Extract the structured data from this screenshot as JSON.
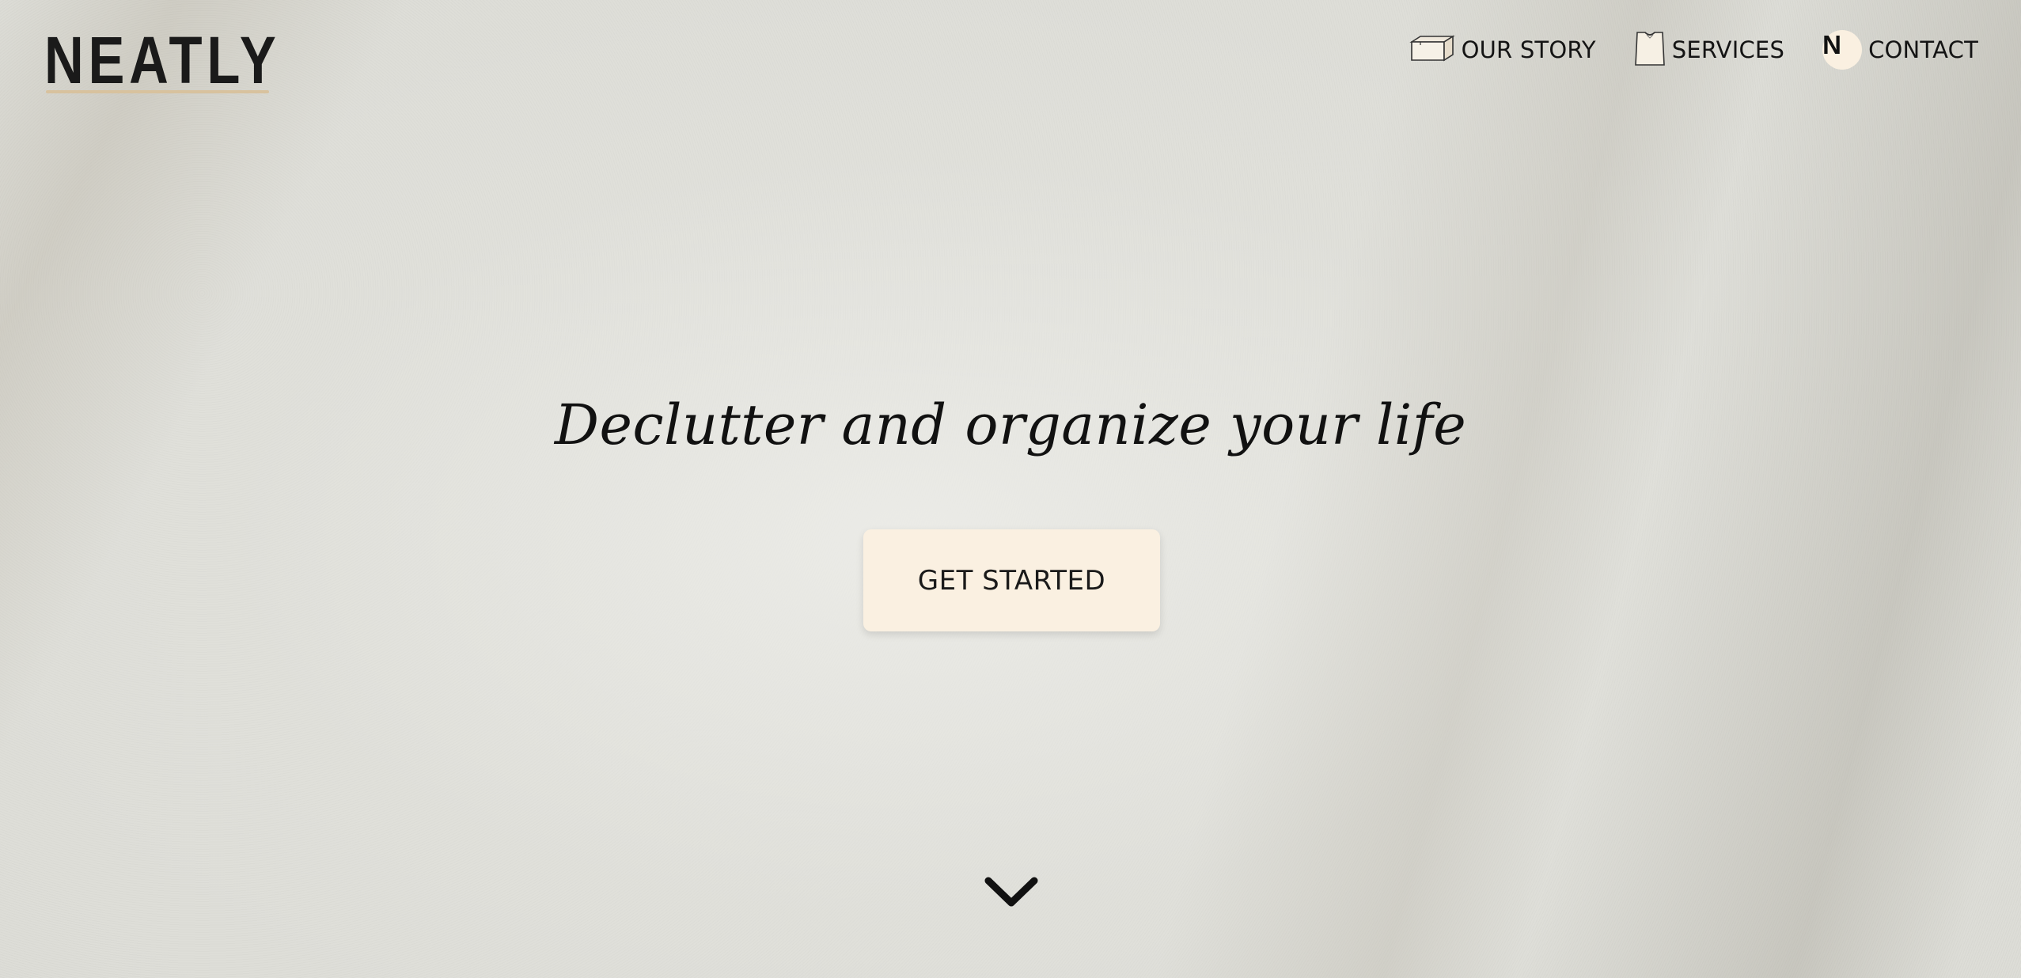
{
  "brand": {
    "logo_text": "NEATLY",
    "accent_color": "#d8c29e",
    "cream_color": "#faf0e1"
  },
  "nav": {
    "items": [
      {
        "label": "OUR STORY",
        "icon": "box-icon"
      },
      {
        "label": "SERVICES",
        "icon": "shirt-icon"
      },
      {
        "label": "CONTACT",
        "icon": "n-badge-icon",
        "badge_letter": "N"
      }
    ]
  },
  "hero": {
    "headline": "Declutter and organize your life",
    "cta_label": "GET STARTED"
  },
  "scroll": {
    "icon": "chevron-down-icon"
  }
}
